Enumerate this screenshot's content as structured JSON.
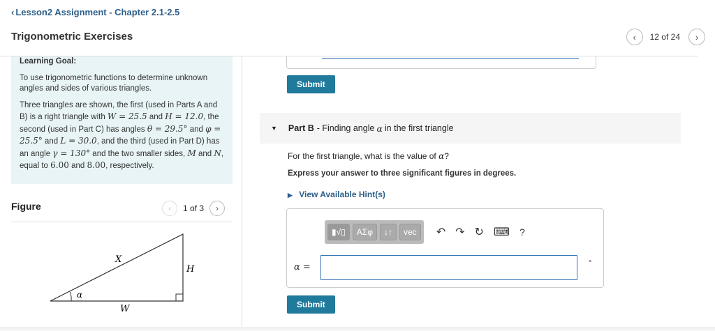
{
  "nav": {
    "back_icon": "‹",
    "back_label": "Lesson2 Assignment - Chapter 2.1-2.5",
    "page_title": "Trigonometric Exercises",
    "prev_icon": "‹",
    "next_icon": "›",
    "position": "12 of 24"
  },
  "goal": {
    "title": "Learning Goal:",
    "intro": "To use trigonometric functions to determine unknown angles and sides of various triangles.",
    "p1": "Three triangles are shown, the first (used in Parts A and B) is a right triangle with",
    "W": "W = 25.5",
    "and1": "and",
    "H": "H = 12.0",
    "p2": ", the second (used in Part C) has angles",
    "theta": "θ = 29.5°",
    "and2": "and",
    "phi": "φ = 25.5°",
    "and3": "and",
    "L": "L = 30.0",
    "p3": ", and the third (used in Part D) has an angle",
    "gamma": "γ = 130°",
    "p4": "and the two smaller sides,",
    "M": "M",
    "and4": "and",
    "N": "N",
    "p5": ", equal to",
    "v1": "6.00",
    "and5": "and",
    "v2": "8.00",
    "p6": ", respectively."
  },
  "figure": {
    "title": "Figure",
    "position": "1 of 3",
    "label_x": "X",
    "label_h": "H",
    "label_w": "W",
    "label_alpha": "α"
  },
  "partA": {
    "submit_label": "Submit"
  },
  "partB": {
    "expand_icon": "▼",
    "label": "Part B",
    "title_pre": "- Finding angle",
    "title_alpha": "α",
    "title_post": "in the first triangle",
    "question_pre": "For the first triangle, what is the value of",
    "question_alpha": "α",
    "question_post": "?",
    "instruction": "Express your answer to three significant figures in degrees.",
    "hint_icon": "▶",
    "hint_label": "View Available Hint(s)",
    "toolbar": {
      "template_label": "▮√▯",
      "greek_label": "ΑΣφ",
      "arrows_label": "↓↑",
      "vec_label": "vec",
      "undo_icon": "↶",
      "redo_icon": "↷",
      "reset_icon": "↻",
      "keyboard_icon": "⌨",
      "help_label": "?"
    },
    "answer_var": "α",
    "answer_eq": "=",
    "answer_value": "",
    "unit": "°",
    "submit_label": "Submit"
  }
}
